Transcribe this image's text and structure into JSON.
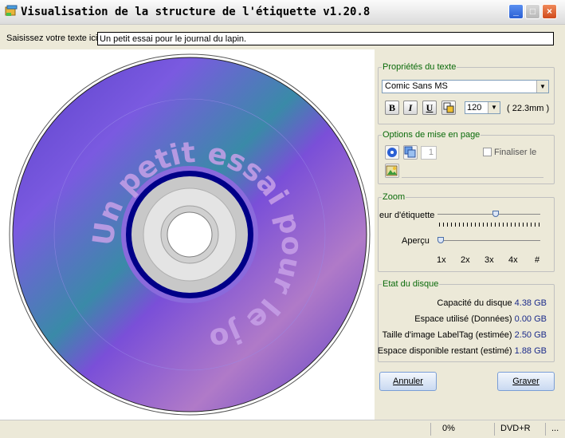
{
  "window": {
    "title": "Visualisation de la structure de l'étiquette v1.20.8"
  },
  "text_input": {
    "label": "Saisissez votre texte ici",
    "value": "Un petit essai pour le journal du lapin."
  },
  "disc": {
    "curved_text": "Un petit essai pour le journal du lapin."
  },
  "text_props": {
    "legend": "Propriétés du texte",
    "font": "Comic Sans MS",
    "bold": "B",
    "italic": "I",
    "underline": "U",
    "size": "120",
    "size_mm": "( 22.3mm )"
  },
  "layout_options": {
    "legend": "Options de mise en page",
    "count": "1",
    "finalize_label": "Finaliser le"
  },
  "zoom": {
    "legend": "Zoom",
    "label_slider": "eur d'étiquette",
    "preview_label": "Aperçu",
    "label_level": 0.57,
    "preview_level": 0.0,
    "preview_ticks": [
      "1x",
      "2x",
      "3x",
      "4x",
      "#"
    ]
  },
  "disc_state": {
    "legend": "Etat du disque",
    "rows": [
      {
        "label": "Capacité du disque",
        "value": "4.38 GB"
      },
      {
        "label": "Espace utilisé (Données)",
        "value": "0.00 GB"
      },
      {
        "label": "Taille d'image LabelTag (estimée)",
        "value": "2.50 GB"
      },
      {
        "label": "Espace disponible restant (estimé)",
        "value": "1.88 GB"
      }
    ]
  },
  "buttons": {
    "cancel": "Annuler",
    "burn": "Graver"
  },
  "statusbar": {
    "progress": "0%",
    "media": "DVD+R",
    "more": "..."
  },
  "colors": {
    "disc_purple": "#6a4fd0",
    "legend_green": "#0a6a0a",
    "value_blue": "#1a2a8a"
  }
}
